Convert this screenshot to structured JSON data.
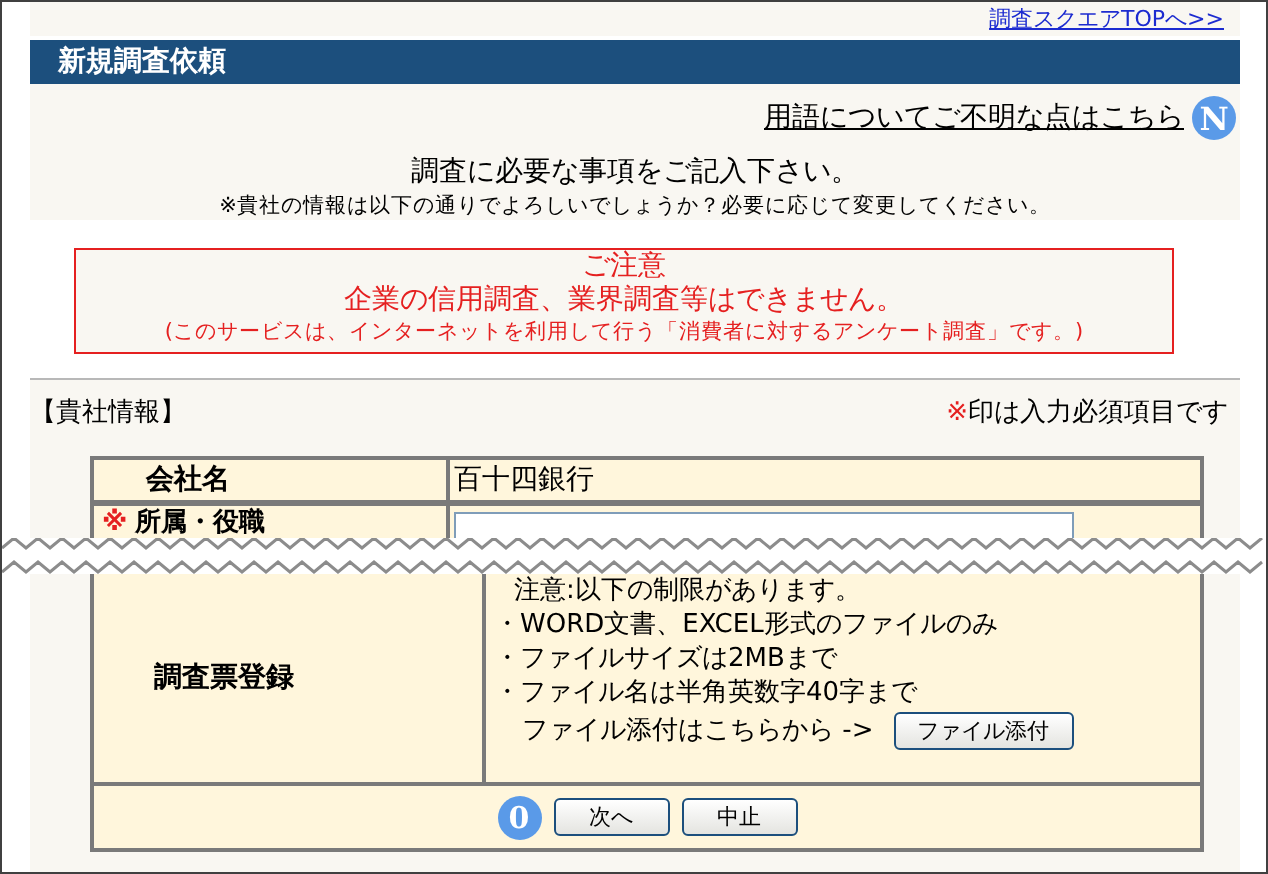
{
  "top_link": "調査スクエアTOPへ>>",
  "title": "新規調査依頼",
  "help_link": "用語についてご不明な点はこちら",
  "help_badge": "N",
  "instruction": "調査に必要な事項をご記入下さい。",
  "note": "※貴社の情報は以下の通りでよろしいでしょうか？必要に応じて変更してください。",
  "caution": {
    "heading": "ご注意",
    "message": "企業の信用調査、業界調査等はできません。",
    "detail": "(このサービスは、インターネットを利用して行う「消費者に対するアンケート調査」です。)"
  },
  "section_title": "【貴社情報】",
  "required_note": {
    "mark": "※",
    "text": "印は入力必須項目です"
  },
  "fields": [
    {
      "kind": "text",
      "label": "会社名",
      "value": "百十四銀行"
    },
    {
      "kind": "input",
      "label": "所属・役職",
      "mark": "※"
    }
  ],
  "upload": {
    "label": "調査票登録",
    "notes": [
      "注意:以下の制限があります。",
      "・WORD文書、EXCEL形式のファイルのみ",
      "・ファイルサイズは2MBまで",
      "・ファイル名は半角英数字40字まで"
    ],
    "prompt": "ファイル添付はこちらから ->",
    "button": "ファイル添付"
  },
  "nav_badge": "0",
  "buttons": [
    "次へ",
    "中止"
  ]
}
